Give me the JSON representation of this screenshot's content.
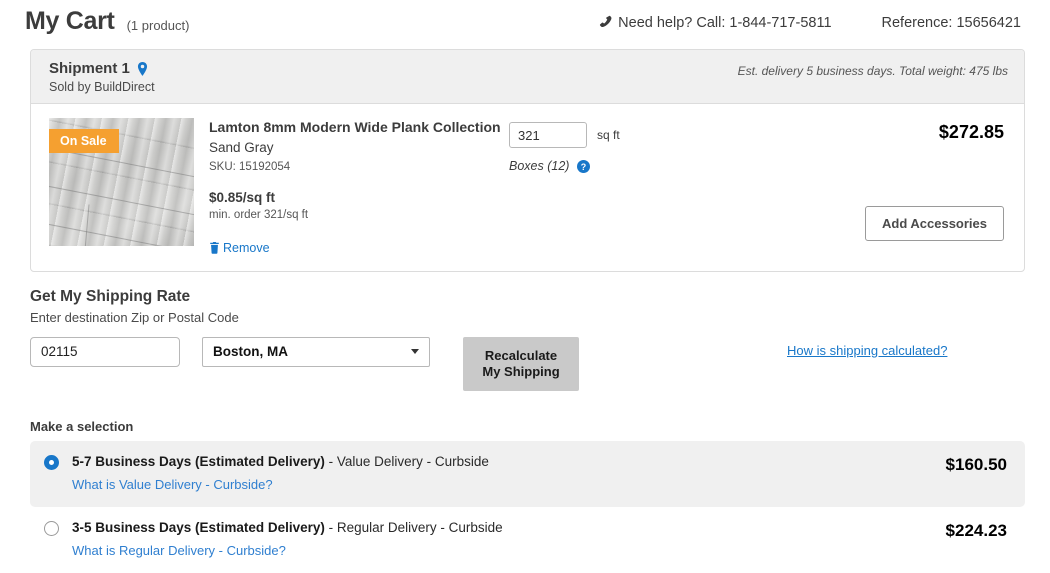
{
  "header": {
    "title": "My Cart",
    "product_count": "(1 product)",
    "phone_icon": "phone-icon",
    "need_help": "Need help? Call: 1-844-717-5811",
    "reference": "Reference: 15656421"
  },
  "shipment": {
    "title": "Shipment 1",
    "pin_icon": "location-pin-icon",
    "sold_by": "Sold by BuildDirect",
    "meta": "Est. delivery 5 business days. Total weight: 475 lbs",
    "accent_blue": "#1877c9",
    "badge_orange": "#f5a030"
  },
  "product": {
    "sale_badge": "On Sale",
    "thumb_icon": "product-image-wood-plank",
    "name": "Lamton 8mm Modern Wide Plank Collection",
    "color": "Sand Gray",
    "sku": "SKU: 15192054",
    "unit_price": "$0.85/sq ft",
    "min_order": "min. order 321/sq ft",
    "remove_label": "Remove",
    "remove_icon": "trash-icon",
    "quantity": "321",
    "quantity_placeholder": "",
    "quantity_unit": "sq ft",
    "boxes_label": "Boxes (12)",
    "boxes_help_icon": "help-circle-icon",
    "line_total": "$272.85",
    "add_accessories_label": "Add Accessories"
  },
  "shipping": {
    "title": "Get My Shipping Rate",
    "subtitle": "Enter destination Zip or Postal Code",
    "zip_value": "02115",
    "zip_placeholder": "Zip or Postal Code",
    "city_selected": "Boston, MA",
    "city_caret_icon": "chevron-down-icon",
    "recalculate_line1": "Recalculate",
    "recalculate_line2": "My Shipping",
    "how_link": "How is shipping calculated?",
    "make_selection": "Make a selection",
    "options": [
      {
        "days": "5-7 Business Days (Estimated Delivery)",
        "separator": " - ",
        "method": "Value Delivery - Curbside",
        "link": "What is Value Delivery - Curbside?",
        "price": "$160.50",
        "selected": true
      },
      {
        "days": "3-5 Business Days (Estimated Delivery)",
        "separator": " - ",
        "method": "Regular Delivery - Curbside",
        "link": "What is Regular Delivery - Curbside?",
        "price": "$224.23",
        "selected": false
      }
    ]
  }
}
